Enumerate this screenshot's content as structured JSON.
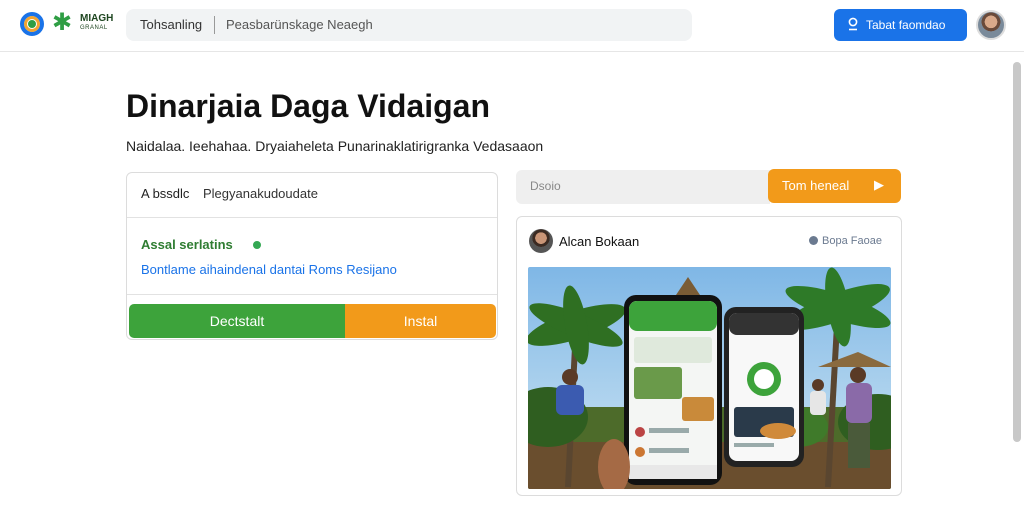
{
  "header": {
    "brand_name": "MIAGH",
    "brand_sub": "GRANAL",
    "search_keyword": "Tohsanling",
    "search_query": "Peasbarünskage Neaegh",
    "action_button_label": "Tabat faomdao"
  },
  "hero": {
    "title": "Dinarjaia Daga Vidaigan",
    "subtitle": "Naidalaa. Ieehahaa. Dryaiaheleta Punarinaklatirigranka Vedasaaon"
  },
  "left_card": {
    "chip_1": "A bssdlc",
    "chip_2": "Plegyanakudoudate",
    "status_text": "Assal serlatins",
    "link_text": "Bontlame aihaindenal dantai Roms Resijano",
    "button_primary": "Dectstalt",
    "button_secondary": "Instal"
  },
  "right_panel": {
    "search_placeholder": "Dsoio",
    "search_button": "Tom heneal",
    "post_author": "Alcan Bokaan",
    "post_tag": "Bopa Faoae"
  },
  "colors": {
    "primary_blue": "#1a73e8",
    "brand_green": "#3da33b",
    "accent_orange": "#f29a1a"
  }
}
